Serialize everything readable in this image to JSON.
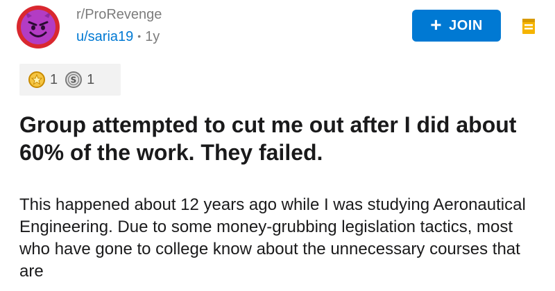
{
  "post": {
    "subreddit": "r/ProRevenge",
    "author": "u/saria19",
    "separator": "•",
    "age": "1y",
    "join_label": "JOIN",
    "join_icon": "plus-icon",
    "awards": [
      {
        "icon": "gold-star-award-icon",
        "count": "1"
      },
      {
        "icon": "silver-award-icon",
        "count": "1"
      }
    ],
    "title": "Group attempted to cut me out after I did about 60% of the work. They failed.",
    "body": "This happened about 12 years ago while I was studying Aeronautical Engineering. Due to some money-grubbing legislation tactics, most who have gone to college know about the unnecessary courses that are"
  },
  "colors": {
    "accent": "#0079d3",
    "avatar_ring": "#d9282f",
    "avatar_face": "#b33cc4",
    "mod_icon": "#f5b400",
    "muted_text": "#7c7c7c"
  }
}
